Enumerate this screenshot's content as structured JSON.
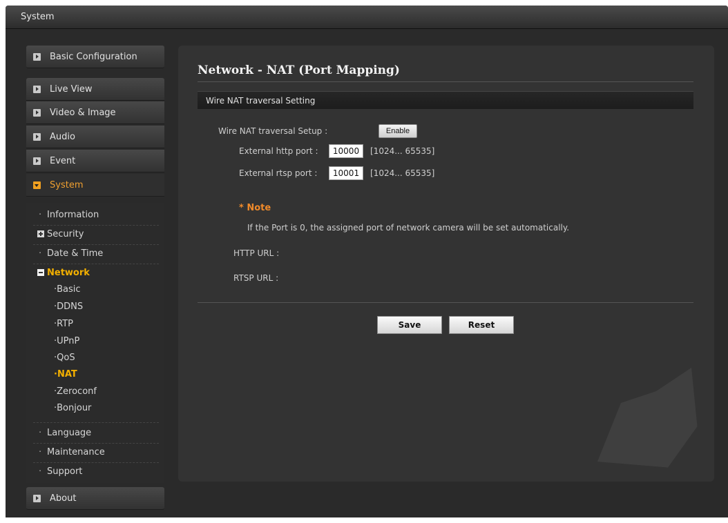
{
  "window": {
    "title": "System"
  },
  "sidebar": {
    "basic_config": "Basic Configuration",
    "items": [
      "Live View",
      "Video & Image",
      "Audio",
      "Event",
      "System"
    ],
    "system_sub": {
      "information": "Information",
      "security": "Security",
      "date_time": "Date & Time",
      "network": "Network",
      "network_items": [
        "Basic",
        "DDNS",
        "RTP",
        "UPnP",
        "QoS",
        "NAT",
        "Zeroconf",
        "Bonjour"
      ],
      "language": "Language",
      "maintenance": "Maintenance",
      "support": "Support"
    },
    "about": "About"
  },
  "main": {
    "title": "Network - NAT (Port Mapping)",
    "section_title": "Wire NAT traversal Setting",
    "setup_label": "Wire NAT traversal Setup :",
    "enable_label": "Enable",
    "http_port_label": "External http port :",
    "http_port_value": "10000",
    "http_port_range": "[1024... 65535]",
    "rtsp_port_label": "External rtsp port :",
    "rtsp_port_value": "10001",
    "rtsp_port_range": "[1024... 65535]",
    "note_title": "* Note",
    "note_text": "If the Port is 0, the assigned port of network camera will be set automatically.",
    "http_url_label": "HTTP URL :",
    "rtsp_url_label": "RTSP URL :",
    "save_label": "Save",
    "reset_label": "Reset"
  },
  "colors": {
    "accent": "#f3b000",
    "note": "#f08a2a",
    "panel": "#333333"
  }
}
